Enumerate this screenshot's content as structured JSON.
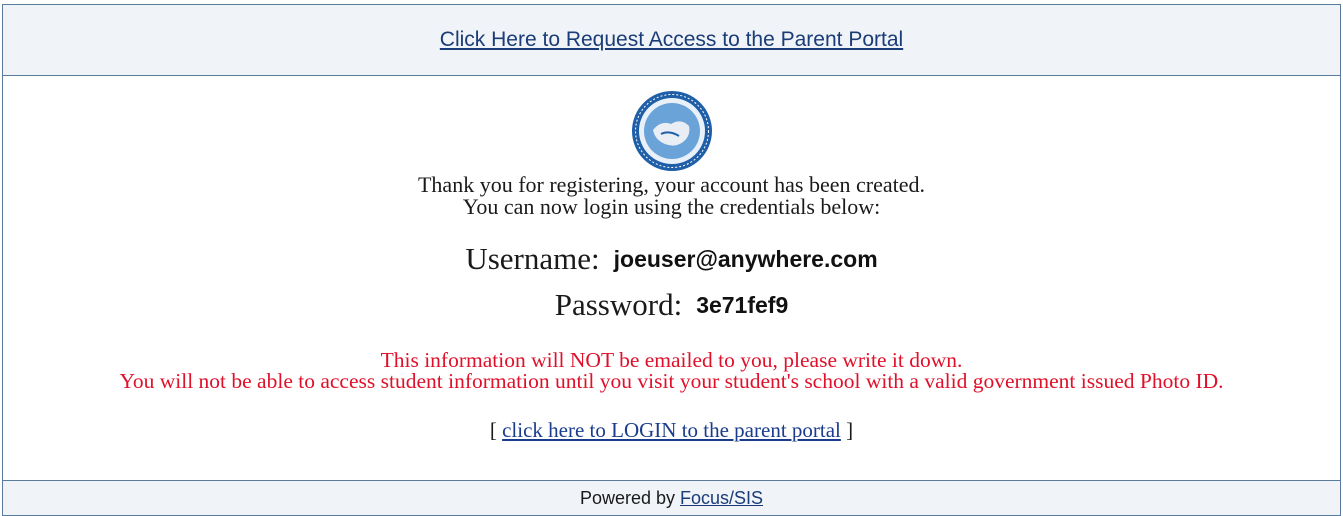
{
  "header": {
    "request_access_link": "Click Here to Request Access to the Parent Portal"
  },
  "logo": {
    "icon": "school-district-seal",
    "colors": {
      "outer": "#1f5fa8",
      "ring": "#e8f0fa",
      "inner": "#5a9bd5"
    }
  },
  "message": {
    "line1": "Thank you for registering, your account has been created.",
    "line2": "You can now login using the credentials below:"
  },
  "credentials": {
    "username_label": "Username:",
    "username_value": "joeuser@anywhere.com",
    "password_label": "Password:",
    "password_value": "3e71fef9"
  },
  "warning": {
    "line1": "This information will NOT be emailed to you, please write it down.",
    "line2": "You will not be able to access student information until you visit your student's school with a valid government issued Photo ID."
  },
  "login": {
    "bracket_open": "[",
    "link_text": "click here to LOGIN to the parent portal",
    "bracket_close": "]"
  },
  "footer": {
    "powered_by": "Powered by",
    "product_link": "Focus/SIS"
  },
  "colors": {
    "link": "#1a3c78",
    "warning": "#e0102a",
    "bar_background": "#f0f3f7",
    "border": "#5a7b9c"
  }
}
